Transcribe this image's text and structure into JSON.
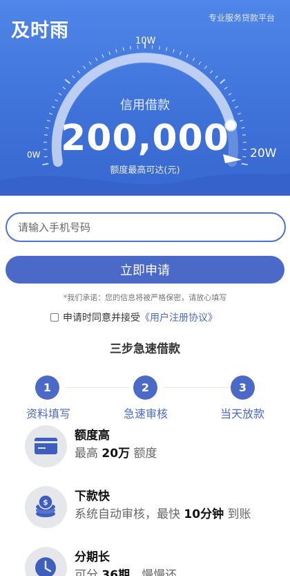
{
  "header": {
    "brand": "及时雨",
    "slogan": "专业服务贷款平台"
  },
  "gauge": {
    "min_label": "0W",
    "mid_label": "10W",
    "max_label": "20W",
    "level": 0.88
  },
  "credit": {
    "title": "信用借款",
    "amount": "200,000",
    "note": "额度最高可达(元)"
  },
  "form": {
    "phone_placeholder": "请输入手机号码",
    "apply_label": "立即申请",
    "promise": "*我们承诺：您的信息将被严格保密，请放心填写",
    "agree_text": "申请时同意并接受",
    "agree_link": "《用户注册协议》"
  },
  "steps": {
    "title": "三步急速借款",
    "items": [
      {
        "number": "1",
        "label": "资料填写"
      },
      {
        "number": "2",
        "label": "急速审核"
      },
      {
        "number": "3",
        "label": "当天放款"
      }
    ]
  },
  "features": [
    {
      "icon": "credit-card-icon",
      "title": "额度高",
      "desc_pre": "最高 ",
      "desc_bold": "20万",
      "desc_post": " 额度"
    },
    {
      "icon": "coin-stack-icon",
      "title": "下款快",
      "desc_pre": "系统自动审核，最快 ",
      "desc_bold": "10分钟",
      "desc_post": " 到账"
    },
    {
      "icon": "clock-icon",
      "title": "分期长",
      "desc_pre": "可分 ",
      "desc_bold": "36期",
      "desc_post": "，慢慢还"
    }
  ],
  "colors": {
    "accent": "#4b69c7",
    "hero_top": "#4f86e8",
    "hero_bottom": "#3867cf"
  }
}
